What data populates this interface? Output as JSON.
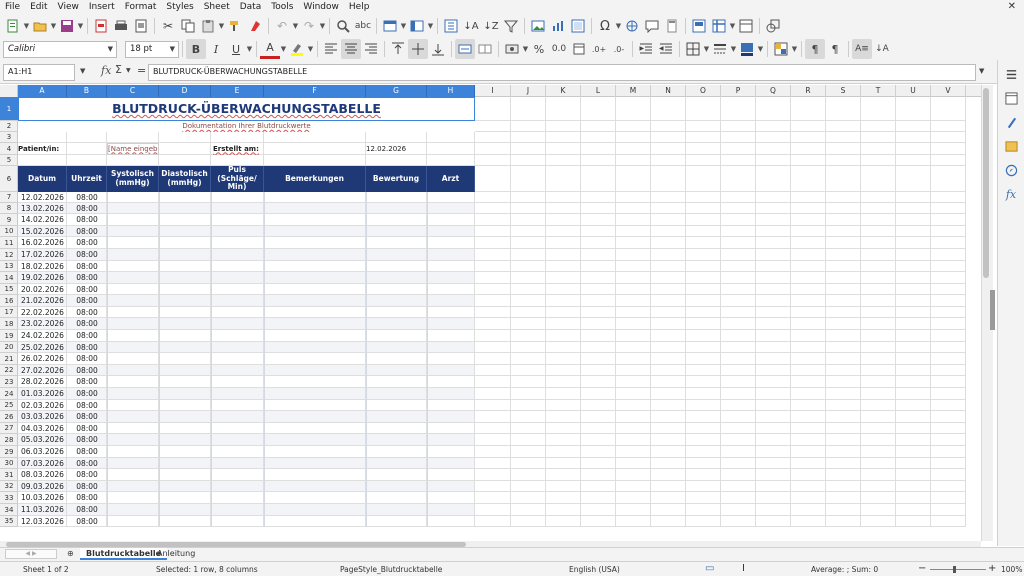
{
  "menu": [
    "File",
    "Edit",
    "View",
    "Insert",
    "Format",
    "Styles",
    "Sheet",
    "Data",
    "Tools",
    "Window",
    "Help"
  ],
  "menu_close": "✕",
  "font_name": "Calibri",
  "font_size": "18 pt",
  "name_box": "A1:H1",
  "formula": "BLUTDRUCK-ÜBERWACHUNGSTABELLE",
  "columns": [
    "A",
    "B",
    "C",
    "D",
    "E",
    "F",
    "G",
    "H",
    "I",
    "J",
    "K",
    "L",
    "M",
    "N",
    "O",
    "P",
    "Q",
    "R",
    "S",
    "T",
    "U",
    "V"
  ],
  "rows": [
    "1",
    "2",
    "3",
    "4",
    "5",
    "6",
    "7",
    "8",
    "9",
    "10",
    "11",
    "12",
    "13",
    "14",
    "15",
    "16",
    "17",
    "18",
    "19",
    "20",
    "21",
    "22",
    "23",
    "24",
    "25",
    "26",
    "27",
    "28",
    "29",
    "30",
    "31",
    "32",
    "33",
    "34",
    "35"
  ],
  "sheet": {
    "title": "BLUTDRUCK-ÜBERWACHUNGSTABELLE",
    "subtitle": "Dokumentation Ihrer Blutdruckwerte",
    "patient_label": "Patient/in:",
    "patient_placeholder": "[Name eingeben]",
    "created_label": "Erstellt am:",
    "created_date": "12.02.2026",
    "headers": [
      "Datum",
      "Uhrzeit",
      "Systolisch (mmHg)",
      "Diastolisch (mmHg)",
      "Puls (Schläge/ Min)",
      "Bemerkungen",
      "Bewertung",
      "Arzt"
    ],
    "dates": [
      "12.02.2026",
      "13.02.2026",
      "14.02.2026",
      "15.02.2026",
      "16.02.2026",
      "17.02.2026",
      "18.02.2026",
      "19.02.2026",
      "20.02.2026",
      "21.02.2026",
      "22.02.2026",
      "23.02.2026",
      "24.02.2026",
      "25.02.2026",
      "26.02.2026",
      "27.02.2026",
      "28.02.2026",
      "01.03.2026",
      "02.03.2026",
      "03.03.2026",
      "04.03.2026",
      "05.03.2026",
      "06.03.2026",
      "07.03.2026",
      "08.03.2026",
      "09.03.2026",
      "10.03.2026",
      "11.03.2026",
      "12.03.2026"
    ],
    "time": "08:00"
  },
  "tabs": [
    "Blutdrucktabelle",
    "Anleitung"
  ],
  "status": {
    "sheet": "Sheet 1 of 2",
    "selection": "Selected: 1 row, 8 columns",
    "page_style": "PageStyle_Blutdrucktabelle",
    "language": "English (USA)",
    "summary": "Average: ; Sum: 0",
    "zoom": "100%"
  },
  "colors": {
    "header_bg": "#1f3876",
    "title": "#1f3a7a",
    "selection": "#3c83d9"
  }
}
